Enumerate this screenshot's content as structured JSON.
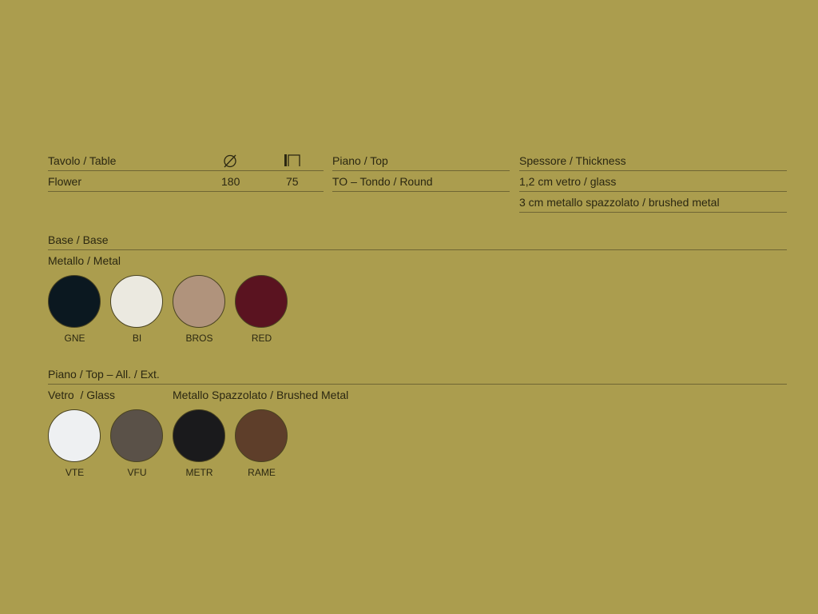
{
  "spec_table": {
    "col_table": {
      "header": "Tavolo / Table",
      "value": "Flower"
    },
    "diameter": {
      "icon": "diameter-icon",
      "value": "180"
    },
    "height": {
      "icon": "table-height-icon",
      "value": "75"
    },
    "col_top": {
      "header": "Piano / Top",
      "value": "TO – Tondo / Round"
    },
    "col_thickness": {
      "header": "Spessore / Thickness",
      "values": [
        "1,2 cm vetro / glass",
        "3 cm metallo spazzolato / brushed metal"
      ]
    }
  },
  "base": {
    "title": "Base / Base",
    "subtitle": "Metallo / Metal",
    "swatches": [
      {
        "code": "GNE",
        "color": "#0b1820"
      },
      {
        "code": "BI",
        "color": "#ebe9e0"
      },
      {
        "code": "BROS",
        "color": "#b0937c"
      },
      {
        "code": "RED",
        "color": "#5a1320"
      }
    ]
  },
  "top": {
    "title": "Piano / Top – All. / Ext.",
    "glass_label": "Vetro  / Glass",
    "metal_label": "Metallo Spazzolato / Brushed Metal",
    "swatches": [
      {
        "code": "VTE",
        "color": "#eef0f2"
      },
      {
        "code": "VFU",
        "color": "#5a5148"
      },
      {
        "code": "METR",
        "color": "#1a1a1c"
      },
      {
        "code": "RAME",
        "color": "#5e3e2a"
      }
    ]
  },
  "colors": {
    "background": "#ab9d4e",
    "rule": "#6f6634",
    "text": "#2b2711"
  }
}
